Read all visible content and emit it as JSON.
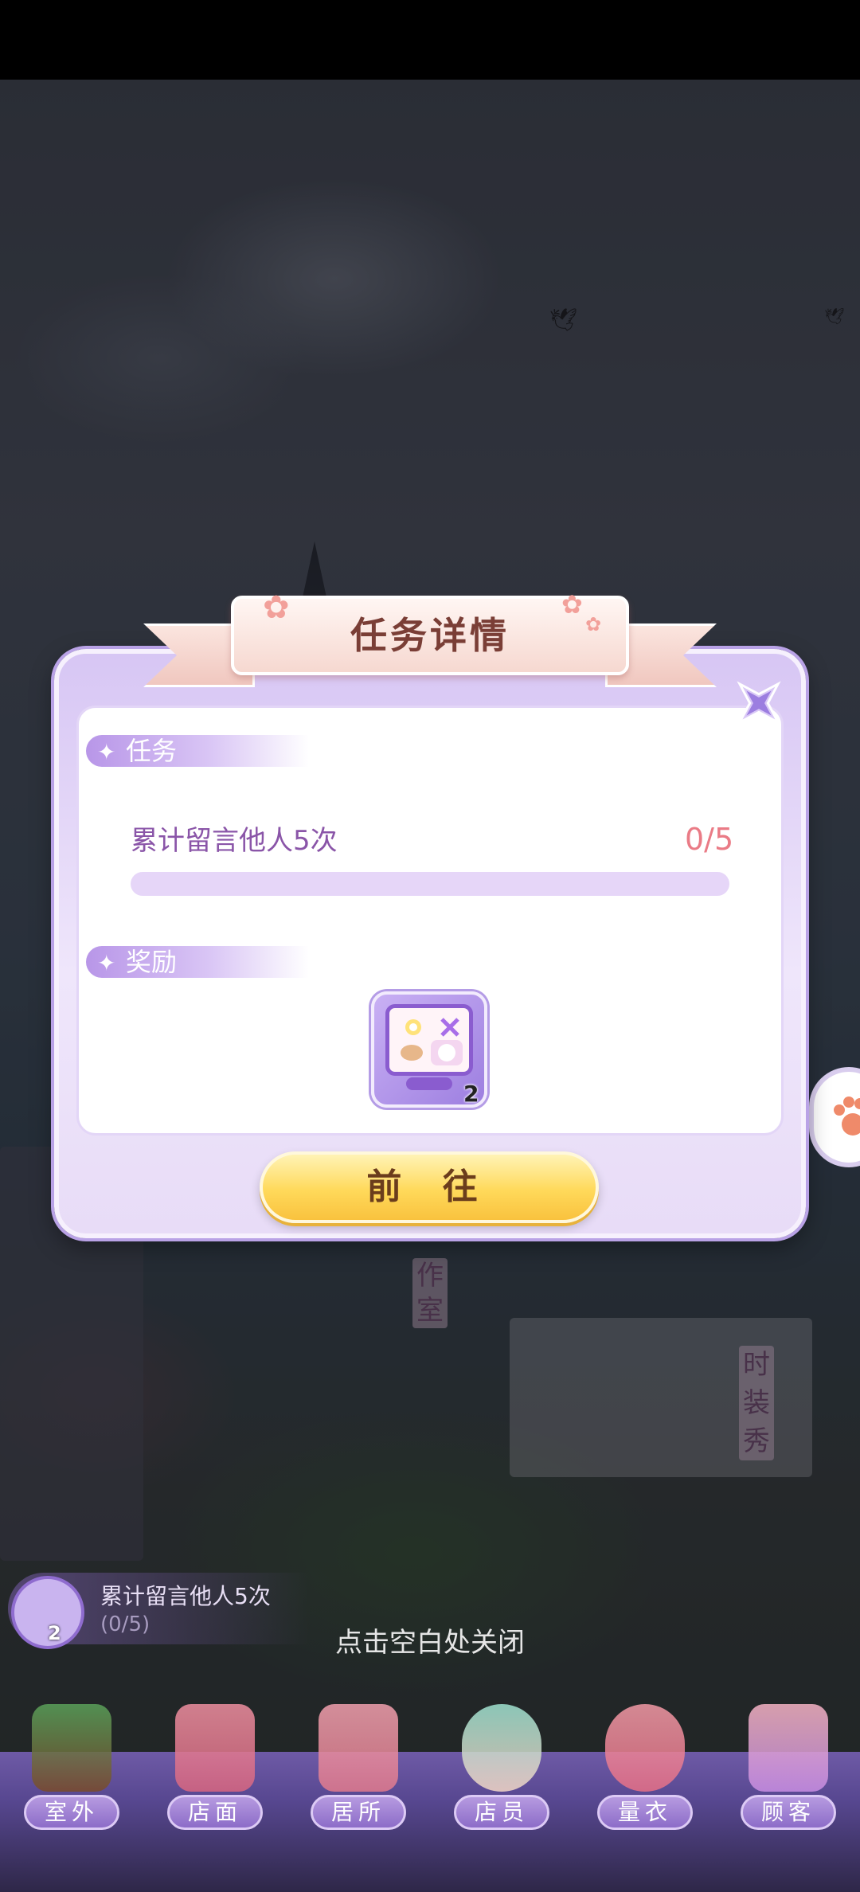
{
  "dialog": {
    "title": "任务详情",
    "task_section_label": "任务",
    "task_description": "累计留言他人5次",
    "task_progress_text": "0/5",
    "task_progress_fraction": 0,
    "reward_section_label": "奖励",
    "reward_item_count": "2",
    "go_button_label": "前 往"
  },
  "task_tracker": {
    "text": "累计留言他人5次",
    "progress": "(0/5)",
    "badge": "2"
  },
  "close_hint": "点击空白处关闭",
  "scene_signs": {
    "studio": "作室",
    "fashion_show": "时装秀"
  },
  "bottom_nav": [
    {
      "label": "室外",
      "icon": "palm-tree-icon"
    },
    {
      "label": "店面",
      "icon": "shop-icon"
    },
    {
      "label": "居所",
      "icon": "house-icon"
    },
    {
      "label": "店员",
      "icon": "staff-icon"
    },
    {
      "label": "量衣",
      "icon": "tape-measure-icon"
    },
    {
      "label": "顾客",
      "icon": "customer-icon"
    }
  ],
  "colors": {
    "accent_purple": "#b390e6",
    "count_red": "#ea7b86",
    "title_brown": "#7a3e36",
    "button_gold": "#ffd95a"
  }
}
